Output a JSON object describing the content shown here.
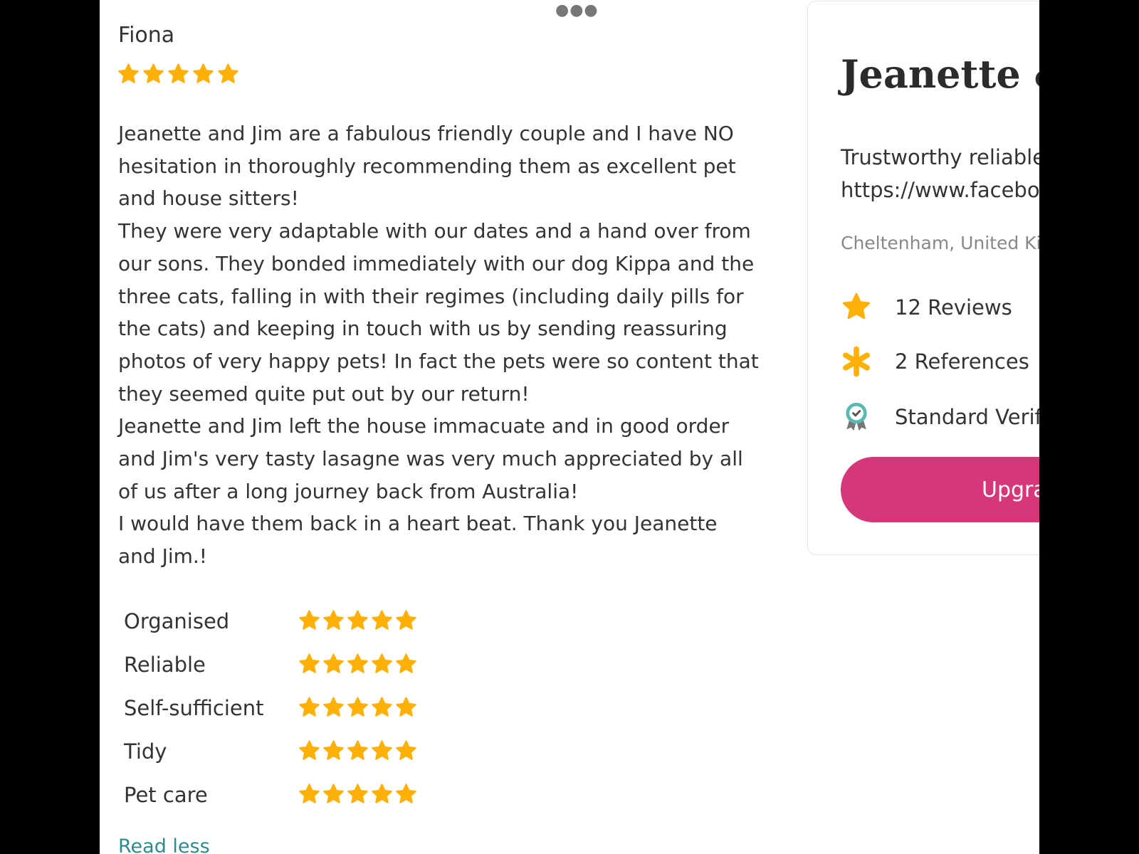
{
  "colors": {
    "star": "#FFB007",
    "accent": "#D63779",
    "link": "#2E8B8B",
    "badge": "#5BB9B3"
  },
  "header": {
    "more_icon": "more-horizontal-icon"
  },
  "review": {
    "reviewer": "Fiona",
    "overall_rating": 5,
    "overall_max": 5,
    "paragraphs": [
      "Jeanette and Jim are a fabulous friendly couple and I have NO hesitation in thoroughly recommending them as excellent pet and house sitters!",
      "They were very adaptable with our dates and a hand over from our sons. They bonded immediately with our dog Kippa and the three cats, falling in with their regimes (including daily pills for the cats) and keeping in touch with us by sending reassuring photos of very happy pets! In fact the pets were so content that they seemed quite put out by our return!",
      "Jeanette and Jim left the house immacuate and in good order and Jim's very tasty lasagne was very much appreciated by all of us after a long journey back from Australia!",
      "I would have them back in a heart beat. Thank you Jeanette and Jim.!"
    ],
    "ratings": [
      {
        "label": "Organised",
        "value": 5,
        "max": 5
      },
      {
        "label": "Reliable",
        "value": 5,
        "max": 5
      },
      {
        "label": "Self-sufficient",
        "value": 5,
        "max": 5
      },
      {
        "label": "Tidy",
        "value": 5,
        "max": 5
      },
      {
        "label": "Pet care",
        "value": 5,
        "max": 5
      }
    ],
    "read_less": "Read less"
  },
  "profile": {
    "name": "Jeanette &",
    "tagline_line1": "Trustworthy reliable",
    "tagline_line2": "https://www.facebo",
    "location": "Cheltenham, United Ki",
    "stats": {
      "reviews": {
        "label": "12 Reviews",
        "icon": "star-icon"
      },
      "references": {
        "label": "2 References",
        "icon": "asterisk-icon"
      },
      "verified": {
        "label": "Standard Verif",
        "icon": "verified-badge-icon"
      }
    },
    "upgrade_label": "Upgra"
  }
}
